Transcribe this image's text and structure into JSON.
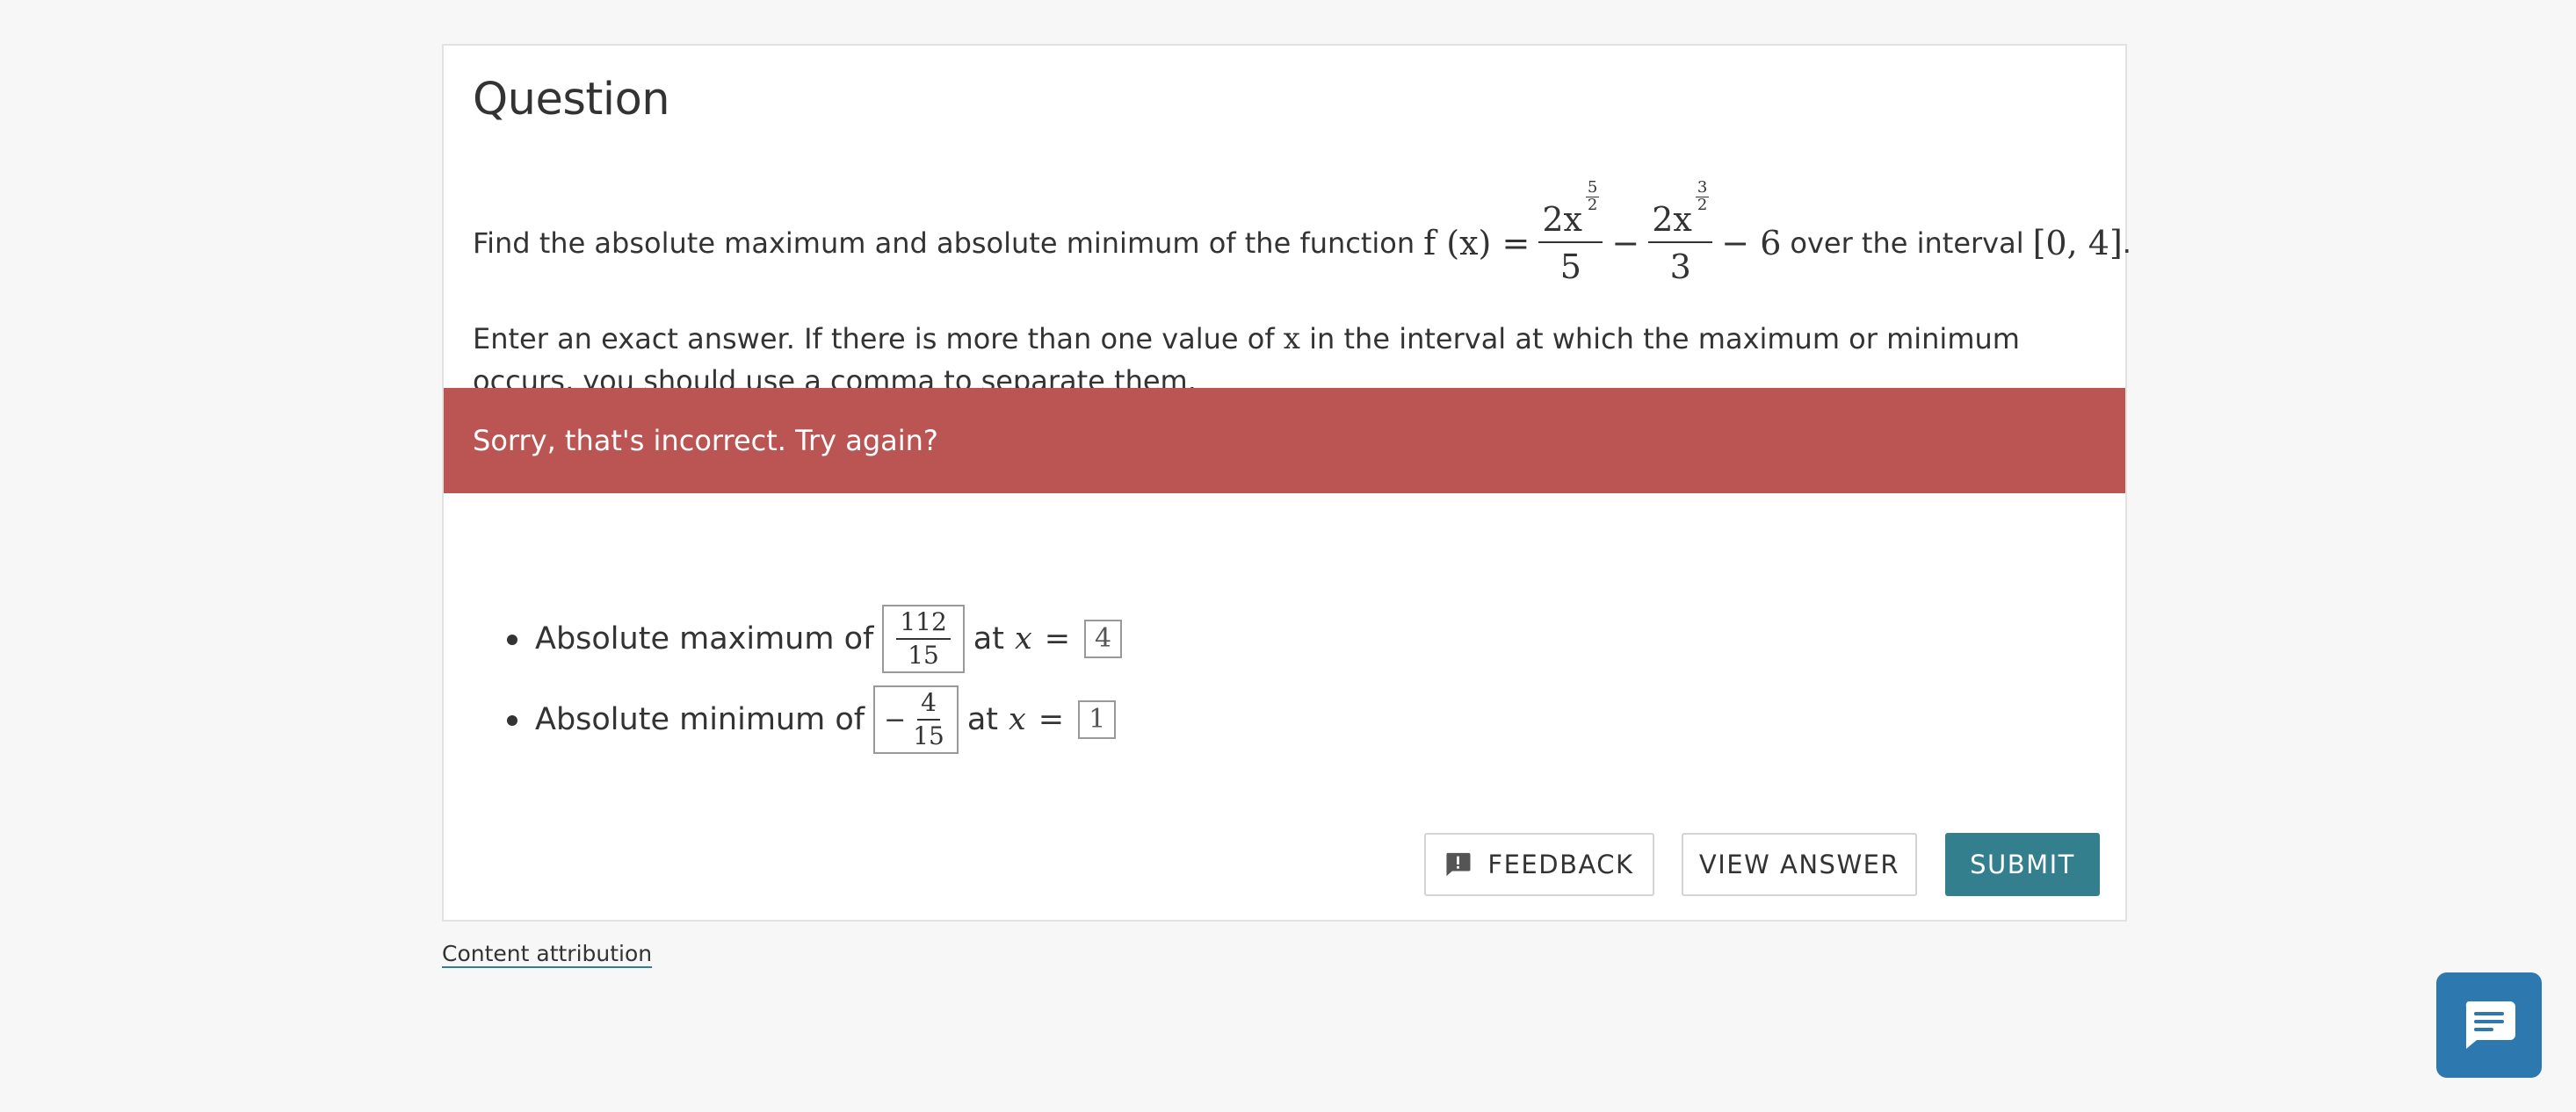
{
  "question": {
    "title": "Question",
    "prompt_prefix": "Find the absolute maximum and absolute minimum of the function",
    "function_lhs": "f (x) =",
    "term1_coef": "2x",
    "term1_exp_num": "5",
    "term1_exp_den": "2",
    "term1_den": "5",
    "minus1": "−",
    "term2_coef": "2x",
    "term2_exp_num": "3",
    "term2_exp_den": "2",
    "term2_den": "3",
    "tail": "− 6",
    "interval_text": "over the interval",
    "interval": "[0, 4]",
    "period": ".",
    "instructions_part1": "Enter an exact answer. If there is more than one value of",
    "instructions_var": "x",
    "instructions_part2": "in the interval at which the maximum or minimum occurs, you should use a comma to separate them."
  },
  "feedback_banner": {
    "message": "Sorry, that's incorrect. Try again?",
    "color": "#bb5554"
  },
  "answers": {
    "max": {
      "label": "Absolute maximum of",
      "value_num": "112",
      "value_den": "15",
      "at_label": "at",
      "var": "x",
      "eq": "=",
      "x_value": "4"
    },
    "min": {
      "label": "Absolute minimum of",
      "value_sign": "−",
      "value_num": "4",
      "value_den": "15",
      "at_label": "at",
      "var": "x",
      "eq": "=",
      "x_value": "1"
    }
  },
  "buttons": {
    "feedback": "FEEDBACK",
    "view_answer": "VIEW ANSWER",
    "submit": "SUBMIT"
  },
  "footer": {
    "attribution": "Content attribution"
  },
  "icons": {
    "feedback": "feedback-icon",
    "chat": "chat-icon"
  },
  "colors": {
    "accent": "#347f8e",
    "error": "#bb5554",
    "chat": "#2e78b0"
  }
}
